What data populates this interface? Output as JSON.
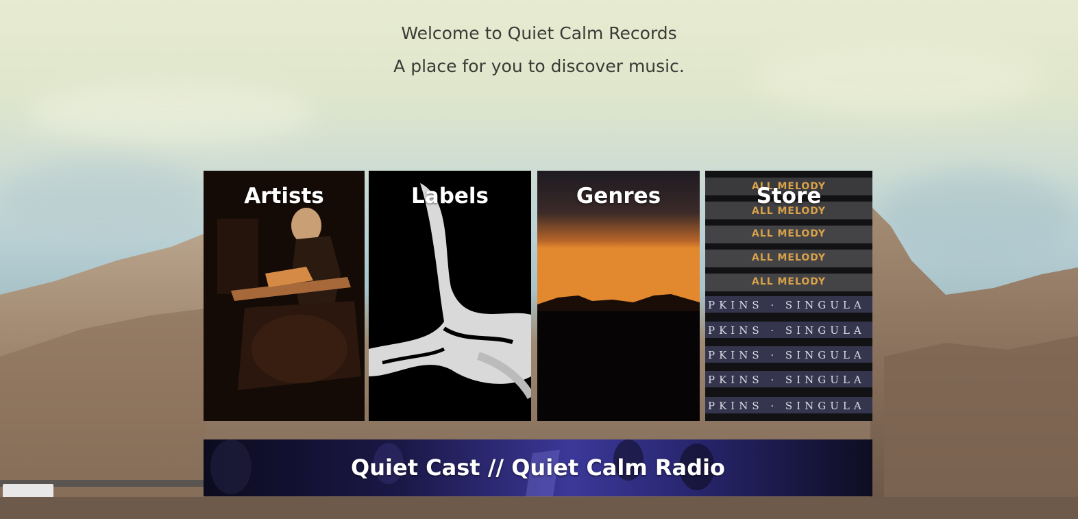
{
  "header": {
    "welcome": "Welcome to Quiet Calm Records",
    "tagline": "A place for you to discover music."
  },
  "tiles": [
    {
      "label": "Artists",
      "image": "musician-playing-guitar-photo"
    },
    {
      "label": "Labels",
      "image": "abstract-swan-artwork"
    },
    {
      "label": "Genres",
      "image": "mountain-sunset-photo"
    },
    {
      "label": "Store",
      "image": "record-spines-photo",
      "spine_text_top": "ALL MELODY",
      "spine_text_bottom": "PKINS · SINGULA"
    }
  ],
  "radio": {
    "label": "Quiet Cast // Quiet Calm Radio",
    "image": "concert-stage-photo"
  },
  "colors": {
    "header_text": "#3a3a36",
    "tile_text": "#ffffff",
    "sky": "#dfe6cb",
    "mountain": "#8f7863"
  }
}
